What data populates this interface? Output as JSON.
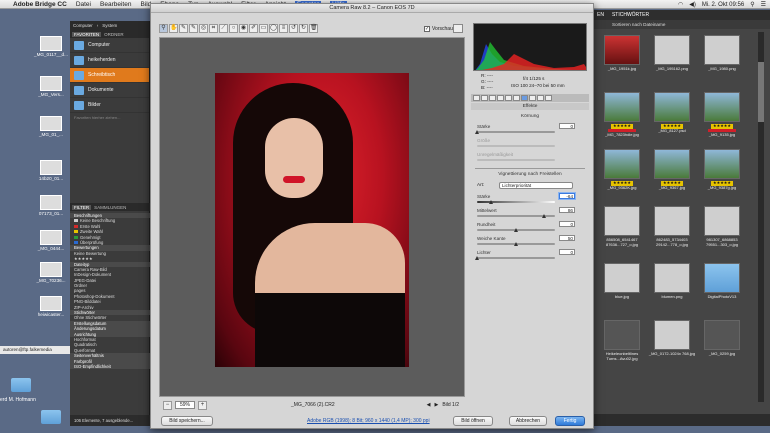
{
  "menubar": {
    "app": "Adobe Bridge CC",
    "items": [
      "Datei",
      "Bearbeiten",
      "Bild",
      "Ebene",
      "Typ",
      "Auswahl",
      "Filter",
      "Ansicht",
      "Fenster",
      "Hilfe"
    ],
    "datetime": "Mi. 2. Okt  09:56"
  },
  "desktop": {
    "icons": [
      "_MG_0117__d...",
      "_MG_Vers...",
      "_MG_01_...",
      "14b20_01...",
      "07173_01...",
      "SANY0...",
      "_MG_0444...",
      "_MG_70236...",
      "heiwicaster..."
    ],
    "path_fragment": "autoren@ftp.falkemedia",
    "user_folder": "erd M. Hofmann"
  },
  "bridge_left": {
    "tabs": [
      "FAVORITEN",
      "ORDNER"
    ],
    "breadcrumb": [
      "Computer",
      "System"
    ],
    "favorites": [
      "Computer",
      "heikeherden",
      "Schreibtisch",
      "Dokumente",
      "Bilder"
    ],
    "favorites_hint": "Favoriten hierher ziehen...",
    "filter_tabs": [
      "FILTER",
      "SAMMLUNGEN"
    ],
    "filters": [
      {
        "label": "Beschriftungen",
        "head": true
      },
      {
        "label": "Keine Beschriftung",
        "color": "#cccccc"
      },
      {
        "label": "Erste Wahl",
        "color": "#d22a2a"
      },
      {
        "label": "Zweite Wahl",
        "color": "#e6c300"
      },
      {
        "label": "Genehmigt",
        "color": "#2a9a3a"
      },
      {
        "label": "Überprüfung",
        "color": "#2a6ad2"
      },
      {
        "label": "Bewertungen",
        "head": true
      },
      {
        "label": "Keine Bewertung"
      },
      {
        "label": "★★★★★"
      },
      {
        "label": "Dateityp",
        "head": true
      },
      {
        "label": "Camera Raw-Bild"
      },
      {
        "label": "InDesign-Dokument"
      },
      {
        "label": "JPEG-Datei"
      },
      {
        "label": "Ordner"
      },
      {
        "label": "pages"
      },
      {
        "label": "Photoshop-Dokument"
      },
      {
        "label": "PNG-Bilddatei"
      },
      {
        "label": "ZIP-Archiv"
      },
      {
        "label": "Stichwörter",
        "head": true
      },
      {
        "label": "Ohne Stichwörter"
      },
      {
        "label": "Erstellungsdatum",
        "head": true
      },
      {
        "label": "Änderungsdatum",
        "head": true
      },
      {
        "label": "Ausrichtung",
        "head": true
      },
      {
        "label": "Hochformat"
      },
      {
        "label": "Quadratisch"
      },
      {
        "label": "Querformat"
      },
      {
        "label": "Seitenverhältnis",
        "head": true
      },
      {
        "label": "Farbprofil",
        "head": true
      },
      {
        "label": "ISO-Empfindlichkeit",
        "head": true
      }
    ],
    "status": "106 Elemente, 7 ausgeblende..."
  },
  "bridge_right": {
    "tabs": [
      "EN",
      "STICHWÖRTER"
    ],
    "sort": "Sortieren nach Dateiname",
    "thumbs": [
      {
        "name": "_MG_1951k.jpg",
        "kind": "red"
      },
      {
        "name": "_MG_195162.png",
        "kind": "plain"
      },
      {
        "name": "_MG_1980.png",
        "kind": "plain"
      },
      {
        "name": "_MG_7823hdle.jpg",
        "kind": "sky",
        "stars": "★★★★★",
        "label": true
      },
      {
        "name": "_MG_8127.psd",
        "kind": "sky",
        "stars": "★★★★★"
      },
      {
        "name": "_MG_9135.jpg",
        "kind": "sky",
        "stars": "★★★★★",
        "label": true
      },
      {
        "name": "_MG_9362K.jpg",
        "kind": "sky",
        "stars": "★★★★★"
      },
      {
        "name": "_MG_9367.jpg",
        "kind": "sky",
        "stars": "★★★★★"
      },
      {
        "name": "_MG_9387g.jpg",
        "kind": "sky",
        "stars": "★★★★★"
      },
      {
        "name": "856508_6541467 87636...727_o.jpg",
        "kind": "plain"
      },
      {
        "name": "862483_5734403 29142...778_o.jpg",
        "kind": "plain"
      },
      {
        "name": "981307_6868853 79551...303_o.jpg",
        "kind": "plain"
      },
      {
        "name": "blue.jpg",
        "kind": "plain"
      },
      {
        "name": "blumen.png",
        "kind": "plain"
      },
      {
        "name": "DigitalPhotoV13",
        "kind": "folder"
      },
      {
        "name": "Heikeleonbeltlines Turns...Avu02.jpg",
        "kind": "dark"
      },
      {
        "name": "_MG_0172-1024x 768.jpg",
        "kind": "plain"
      },
      {
        "name": "_MG_0259.jpg",
        "kind": "dark"
      }
    ]
  },
  "acr": {
    "title": "Camera Raw 8.2 – Canon EOS 7D",
    "preview_label": "Vorschau",
    "zoom": "59%",
    "filename": "_MG_7066 (2).CR2",
    "pager": "Bild 1/2",
    "camera": {
      "r": "R:  ----",
      "g": "G:  ----",
      "b": "B:  ----",
      "exposure": "f/4   1/125 s",
      "iso": "ISO 100   24–70 bei 50 mm"
    },
    "panel_title": "Effekte",
    "grain": {
      "title": "Körnung",
      "staerke": {
        "label": "Stärke",
        "value": "0",
        "pos": 0
      },
      "groesse": {
        "label": "Größe"
      },
      "unregelmaessigkeit": {
        "label": "Unregelmäßigkeit"
      }
    },
    "vignette": {
      "title": "Vignettierung nach Freistellen",
      "art_label": "Art:",
      "art_value": "Lichterpriorität",
      "staerke": {
        "label": "Stärke",
        "value": "-64",
        "pos": 18
      },
      "mittelwert": {
        "label": "Mittelwert",
        "value": "86",
        "pos": 86
      },
      "rundheit": {
        "label": "Rundheit",
        "value": "0",
        "pos": 50
      },
      "weiche_kante": {
        "label": "Weiche Kante",
        "value": "50",
        "pos": 50
      },
      "lichter": {
        "label": "Lichter",
        "value": "0",
        "pos": 0
      }
    },
    "buttons": {
      "save": "Bild speichern...",
      "open": "Bild öffnen",
      "cancel": "Abbrechen",
      "done": "Fertig"
    },
    "workflow": "Adobe RGB (1998); 8 Bit; 960 x 1440 (1,4 MP); 300 ppi"
  }
}
